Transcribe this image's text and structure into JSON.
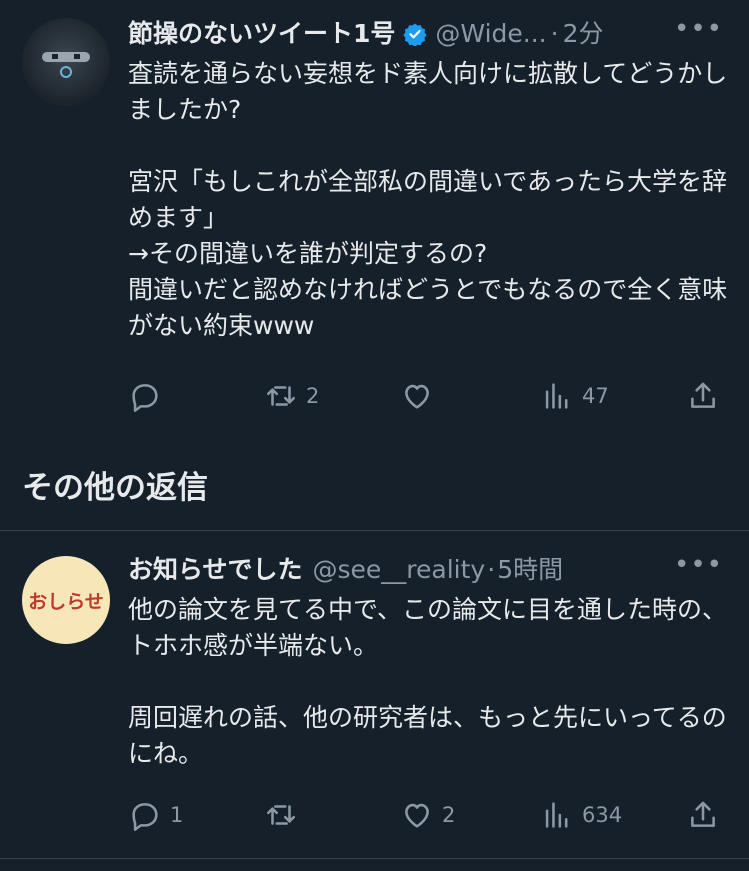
{
  "tweet1": {
    "name": "節操のないツイート1号",
    "handle": "@Wide...",
    "separator": "·",
    "time": "2分",
    "more": "•••",
    "text": "査読を通らない妄想をド素人向けに拡散してどうかしましたか?\n\n宮沢「もしこれが全部私の間違いであったら大学を辞めます」\n→その間違いを誰が判定するの?\n間違いだと認めなければどうとでもなるので全く意味がない約束www",
    "reply_count": "",
    "retweet_count": "2",
    "like_count": "",
    "view_count": "47"
  },
  "section": {
    "title": "その他の返信"
  },
  "tweet2": {
    "name": "お知らせでした",
    "handle": "@see__reality",
    "separator": "·",
    "time": "5時間",
    "more": "•••",
    "avatar_text": "おしらせ",
    "text": "他の論文を見てる中で、この論文に目を通した時の、トホホ感が半端ない。\n\n周回遅れの話、他の研究者は、もっと先にいってるのにね。",
    "reply_count": "1",
    "retweet_count": "",
    "like_count": "2",
    "view_count": "634"
  },
  "colors": {
    "background": "#15202b",
    "text": "#e7e9ea",
    "muted": "#8b98a5",
    "verified": "#1d9bf0",
    "divider": "#38444d"
  }
}
